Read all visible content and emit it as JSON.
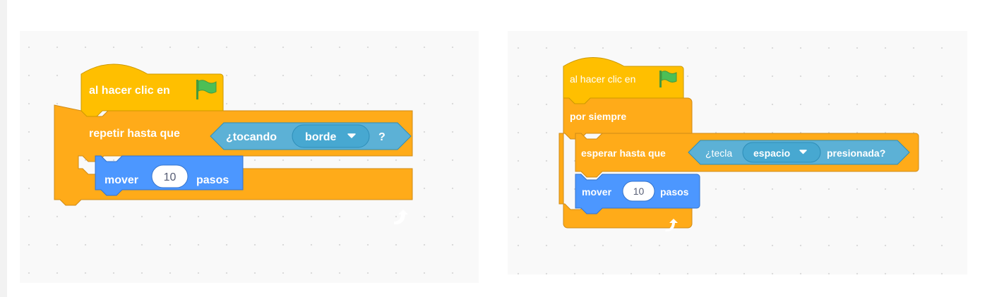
{
  "colors": {
    "events_fill": "#ffbf00",
    "events_stroke": "#cc9900",
    "control_fill": "#ffab19",
    "control_stroke": "#cf8b17",
    "motion_fill": "#4c97ff",
    "motion_stroke": "#3373cc",
    "sensing_fill": "#5cb1d6",
    "sensing_stroke": "#2e8eb8",
    "sensing_dark": "#47a8d1",
    "flag_green": "#4cbf56"
  },
  "script1": {
    "hat_label": "al hacer clic en",
    "flag_icon": "green-flag-icon",
    "repeat_label": "repetir hasta que",
    "touching_label": "¿tocando",
    "touching_menu_value": "borde",
    "touching_suffix": "?",
    "move_label": "mover",
    "move_steps": "10",
    "move_unit": "pasos",
    "loop_arrow_icon": "loop-arrow-icon"
  },
  "script2": {
    "hat_label": "al hacer clic en",
    "flag_icon": "green-flag-icon",
    "forever_label": "por siempre",
    "wait_label": "esperar hasta que",
    "key_label": "¿tecla",
    "key_menu_value": "espacio",
    "key_suffix": "presionada?",
    "move_label": "mover",
    "move_steps": "10",
    "move_unit": "pasos",
    "loop_arrow_icon": "loop-arrow-icon"
  }
}
